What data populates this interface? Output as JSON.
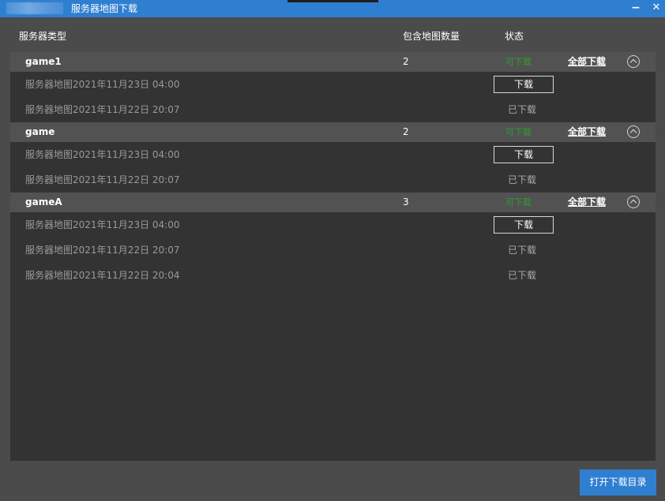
{
  "window": {
    "title": "服务器地图下载",
    "minimize_glyph": "−",
    "close_glyph": "✕"
  },
  "columns": {
    "type": "服务器类型",
    "count": "包含地图数量",
    "status": "状态"
  },
  "groups": [
    {
      "name": "game1",
      "count": "2",
      "status": "可下载",
      "download_all": "全部下载",
      "maps": [
        {
          "name": "服务器地图2021年11月23日 04:00",
          "action": "下载",
          "downloaded": false
        },
        {
          "name": "服务器地图2021年11月22日 20:07",
          "action": "已下载",
          "downloaded": true
        }
      ]
    },
    {
      "name": "game",
      "count": "2",
      "status": "可下载",
      "download_all": "全部下载",
      "maps": [
        {
          "name": "服务器地图2021年11月23日 04:00",
          "action": "下载",
          "downloaded": false
        },
        {
          "name": "服务器地图2021年11月22日 20:07",
          "action": "已下载",
          "downloaded": true
        }
      ]
    },
    {
      "name": "gameA",
      "count": "3",
      "status": "可下载",
      "download_all": "全部下载",
      "maps": [
        {
          "name": "服务器地图2021年11月23日 04:00",
          "action": "下载",
          "downloaded": false
        },
        {
          "name": "服务器地图2021年11月22日 20:07",
          "action": "已下载",
          "downloaded": true
        },
        {
          "name": "服务器地图2021年11月22日 20:04",
          "action": "已下载",
          "downloaded": true
        }
      ]
    }
  ],
  "footer": {
    "open_dir": "打开下载目录"
  },
  "colors": {
    "accent": "#2f7fd1",
    "status_available": "#2f9e2f"
  }
}
